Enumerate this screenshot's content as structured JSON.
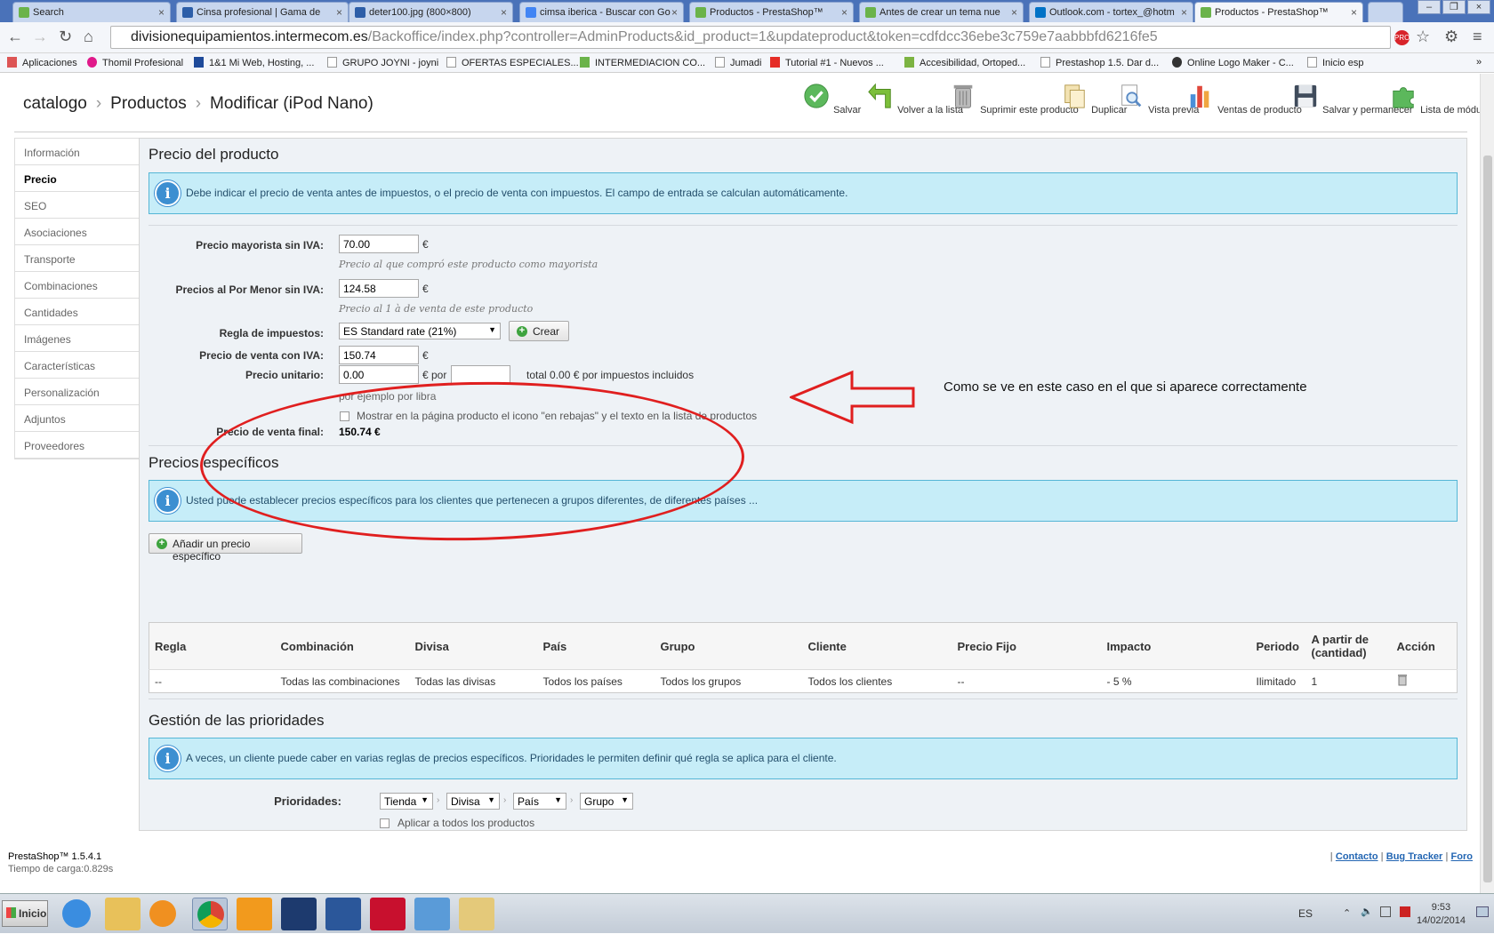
{
  "browser": {
    "tabs": [
      {
        "label": "Search"
      },
      {
        "label": "Cinsa profesional | Gama de"
      },
      {
        "label": "deter100.jpg (800×800)"
      },
      {
        "label": "cimsa iberica - Buscar con Go"
      },
      {
        "label": "Productos - PrestaShop™"
      },
      {
        "label": "Antes de crear un tema nue"
      },
      {
        "label": "Outlook.com - tortex_@hotm"
      },
      {
        "label": "Productos - PrestaShop™"
      }
    ],
    "url_host": "divisionequipamientos.intermecom.es",
    "url_path": "/Backoffice/index.php?controller=AdminProducts&id_product=1&updateproduct&token=cdfdcc36ebe3c759e7aabbbfd6216fe5",
    "bookmarks": [
      "Aplicaciones",
      "Thomil Profesional",
      "1&1 Mi Web, Hosting, ...",
      "GRUPO JOYNI - joyni",
      "OFERTAS ESPECIALES...",
      "INTERMEDIACION CO...",
      "Jumadi",
      "Tutorial #1 - Nuevos ...",
      "Accesibilidad, Ortoped...",
      "Prestashop 1.5. Dar d...",
      "Online Logo Maker - C...",
      "Inicio esp"
    ]
  },
  "header": {
    "breadcrumb": [
      "catalogo",
      "Productos",
      "Modificar (iPod Nano)"
    ],
    "toolbar": [
      {
        "label": "Salvar",
        "icon": "check-icon"
      },
      {
        "label": "Volver a la lista",
        "icon": "back-arrow-icon"
      },
      {
        "label": "Suprimir este producto",
        "icon": "trash-icon"
      },
      {
        "label": "Duplicar",
        "icon": "duplicate-icon"
      },
      {
        "label": "Vista previa",
        "icon": "preview-icon"
      },
      {
        "label": "Ventas de producto",
        "icon": "chart-icon"
      },
      {
        "label": "Salvar y permanecer",
        "icon": "floppy-icon"
      },
      {
        "label": "Lista de módulos",
        "icon": "puzzle-icon"
      }
    ]
  },
  "sidebar": {
    "items": [
      "Información",
      "Precio",
      "SEO",
      "Asociaciones",
      "Transporte",
      "Combinaciones",
      "Cantidades",
      "Imágenes",
      "Características",
      "Personalización",
      "Adjuntos",
      "Proveedores"
    ],
    "active": "Precio"
  },
  "price": {
    "title": "Precio del producto",
    "info": "Debe indicar el precio de venta antes de impuestos, o el precio de venta con impuestos. El campo de entrada se calculan automáticamente.",
    "wholesale_label": "Precio mayorista sin IVA:",
    "wholesale_value": "70.00",
    "wholesale_hint": "Precio al que compró este producto como mayorista",
    "retail_label": "Precios al Por Menor sin IVA:",
    "retail_value": "124.58",
    "retail_hint": "Precio al 1 à de venta de este producto",
    "tax_label": "Regla de impuestos:",
    "tax_value": "ES Standard rate (21%)",
    "create_label": "Crear",
    "with_tax_label": "Precio de venta con IVA:",
    "with_tax_value": "150.74",
    "unit_label": "Precio unitario:",
    "unit_value": "0.00",
    "unit_por": "€ por",
    "unit_total": "total 0.00 € por impuestos incluidos",
    "unit_hint": "por ejemplo por libra",
    "onsale_label": "Mostrar en la página producto el icono \"en rebajas\" y el texto en la lista de productos",
    "final_label": "Precio de venta final:",
    "final_value": "150.74 €",
    "currency": "€"
  },
  "annotation": {
    "text": "Como se ve en este caso en el que si aparece correctamente",
    "color": "#e01f1f"
  },
  "specific": {
    "title": "Precios específicos",
    "info": "Usted puede establecer precios específicos para los clientes que pertenecen a grupos diferentes, de diferentes países ...",
    "add_label": "Añadir un precio específico",
    "columns": [
      "Regla",
      "Combinación",
      "Divisa",
      "País",
      "Grupo",
      "Cliente",
      "Precio Fijo",
      "Impacto",
      "Periodo",
      "A partir de (cantidad)",
      "Acción"
    ],
    "rows": [
      [
        "--",
        "Todas las combinaciones",
        "Todas las divisas",
        "Todos los países",
        "Todos los grupos",
        "Todos los clientes",
        "--",
        "- 5 %",
        "Ilimitado",
        "1",
        ""
      ]
    ]
  },
  "priorities": {
    "title": "Gestión de las prioridades",
    "info": "A veces, un cliente puede caber en varias reglas de precios específicos. Prioridades le permiten definir qué regla se aplica para el cliente.",
    "label": "Prioridades:",
    "selects": [
      "Tienda",
      "Divisa",
      "País",
      "Grupo"
    ],
    "apply_all": "Aplicar a todos los productos"
  },
  "footer": {
    "version": "PrestaShop™ 1.5.4.1",
    "load": "Tiempo de carga:0.829s",
    "links": [
      "Contacto",
      "Bug Tracker",
      "Foro"
    ]
  },
  "taskbar": {
    "start": "Inicio",
    "lang": "ES",
    "time": "9:53",
    "date": "14/02/2014"
  }
}
